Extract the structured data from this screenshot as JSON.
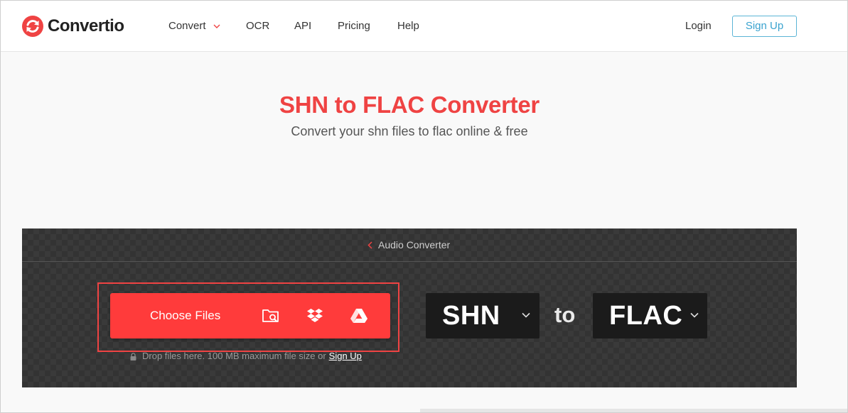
{
  "brand": {
    "name": "Convertio",
    "accent_color": "#ef4343",
    "logo_icon": "convertio-logo-icon"
  },
  "nav": {
    "items": [
      {
        "label": "Convert",
        "icon": "chevron-down-icon"
      },
      {
        "label": "OCR"
      },
      {
        "label": "API"
      },
      {
        "label": "Pricing"
      },
      {
        "label": "Help"
      }
    ],
    "login_label": "Login",
    "signup_label": "Sign Up"
  },
  "hero": {
    "title": "SHN to FLAC Converter",
    "subtitle": "Convert your shn files to flac online & free"
  },
  "converter": {
    "breadcrumb": "Audio Converter",
    "choose_files_label": "Choose Files",
    "source_icons": [
      "folder-search-icon",
      "dropbox-icon",
      "google-drive-icon"
    ],
    "drop_note": "Drop files here. 100 MB maximum file size or",
    "drop_note_link": "Sign Up",
    "from_format": "SHN",
    "to_word": "to",
    "to_format": "FLAC",
    "button_color": "#ff3b3b"
  }
}
